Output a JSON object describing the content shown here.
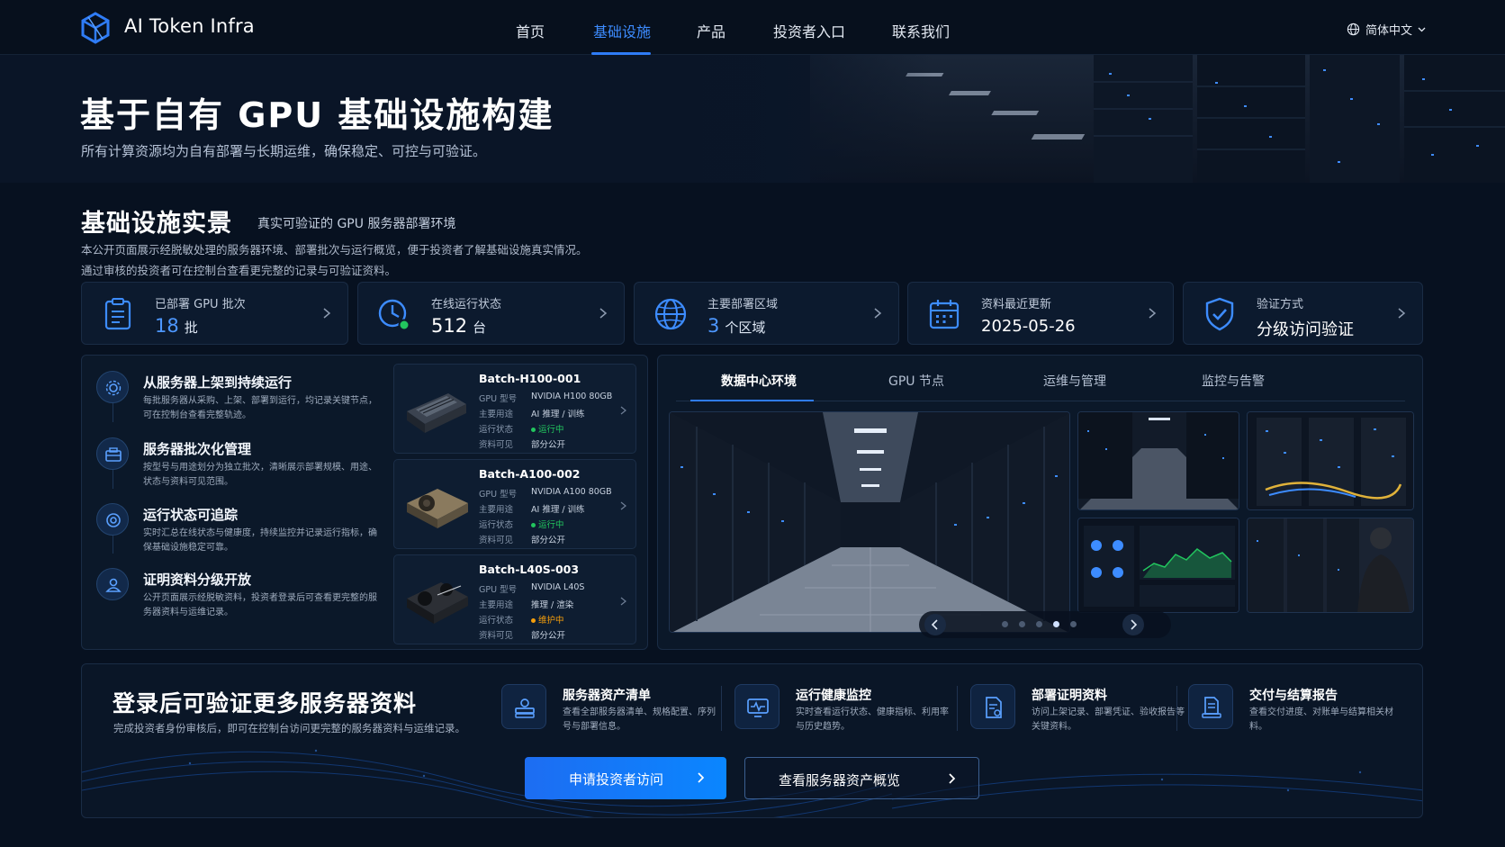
{
  "header": {
    "brand": "AI Token Infra",
    "nav": [
      "首页",
      "基础设施",
      "产品",
      "投资者入口",
      "联系我们"
    ],
    "active_nav": "基础设施",
    "language": "简体中文",
    "accent": "#2f7cf6"
  },
  "hero": {
    "title": "基于自有 GPU 基础设施构建",
    "subtitle": "所有计算资源均为自有部署与长期运维，确保稳定、可控与可验证。"
  },
  "section": {
    "title": "基础设施实景",
    "tag": "真实可验证的 GPU 服务器部署环境",
    "desc_line1": "本公开页面展示经脱敏处理的服务器环境、部署批次与运行概览，便于投资者了解基础设施真实情况。",
    "desc_line2": "通过审核的投资者可在控制台查看更完整的记录与可验证资料。"
  },
  "stats": [
    {
      "label": "已部署 GPU 批次",
      "value": "18",
      "unit": "批",
      "icon": "clipboard-icon"
    },
    {
      "label": "在线运行状态",
      "value": "512",
      "unit": "台",
      "icon": "clock-online-icon"
    },
    {
      "label": "主要部署区域",
      "value": "3",
      "unit": "个区域",
      "icon": "globe-icon"
    },
    {
      "label": "资料最近更新",
      "value": "2025-05-26",
      "unit": "",
      "icon": "calendar-icon"
    },
    {
      "label": "验证方式",
      "value": "分级访问验证",
      "unit": "",
      "icon": "shield-check-icon"
    }
  ],
  "features": [
    {
      "title": "从服务器上架到持续运行",
      "desc": "每批服务器从采购、上架、部署到运行，均记录关键节点，可在控制台查看完整轨迹。",
      "icon": "server-gear-icon"
    },
    {
      "title": "服务器批次化管理",
      "desc": "按型号与用途划分为独立批次，清晰展示部署规模、用途、状态与资料可见范围。",
      "icon": "batch-icon"
    },
    {
      "title": "运行状态可追踪",
      "desc": "实时汇总在线状态与健康度，持续监控并记录运行指标，确保基础设施稳定可靠。",
      "icon": "tracking-icon"
    },
    {
      "title": "证明资料分级开放",
      "desc": "公开页面展示经脱敏资料，投资者登录后可查看更完整的服务器资料与运维记录。",
      "icon": "user-doc-icon"
    }
  ],
  "batch_labels": {
    "model": "GPU 型号",
    "usage": "主要用途",
    "status": "运行状态",
    "visibility": "资料可见"
  },
  "batches": [
    {
      "name": "Batch-H100-001",
      "model": "NVIDIA H100 80GB",
      "usage": "AI 推理 / 训练",
      "status": "运行中",
      "status_color": "#22c55e",
      "visibility": "部分公开"
    },
    {
      "name": "Batch-A100-002",
      "model": "NVIDIA A100 80GB",
      "usage": "AI 推理 / 训练",
      "status": "运行中",
      "status_color": "#22c55e",
      "visibility": "部分公开"
    },
    {
      "name": "Batch-L40S-003",
      "model": "NVIDIA L40S",
      "usage": "推理 / 渲染",
      "status": "维护中",
      "status_color": "#f59e0b",
      "visibility": "部分公开"
    }
  ],
  "gallery": {
    "tabs": [
      "数据中心环境",
      "GPU 节点",
      "运维与管理",
      "监控与告警"
    ],
    "active_tab": "数据中心环境",
    "slides": 5,
    "active_slide": 4
  },
  "cta": {
    "title": "登录后可验证更多服务器资料",
    "subtitle": "完成投资者身份审核后，即可在控制台访问更完整的服务器资料与运维记录。",
    "features": [
      {
        "title": "服务器资产清单",
        "desc": "查看全部服务器清单、规格配置、序列号与部署信息。",
        "icon": "server-stack-icon"
      },
      {
        "title": "运行健康监控",
        "desc": "实时查看运行状态、健康指标、利用率与历史趋势。",
        "icon": "health-monitor-icon"
      },
      {
        "title": "部署证明资料",
        "desc": "访问上架记录、部署凭证、验收报告等关键资料。",
        "icon": "certificate-icon"
      },
      {
        "title": "交付与结算报告",
        "desc": "查看交付进度、对账单与结算相关材料。",
        "icon": "report-icon"
      }
    ],
    "primary_button": "申请投资者访问",
    "secondary_button": "查看服务器资产概览"
  }
}
